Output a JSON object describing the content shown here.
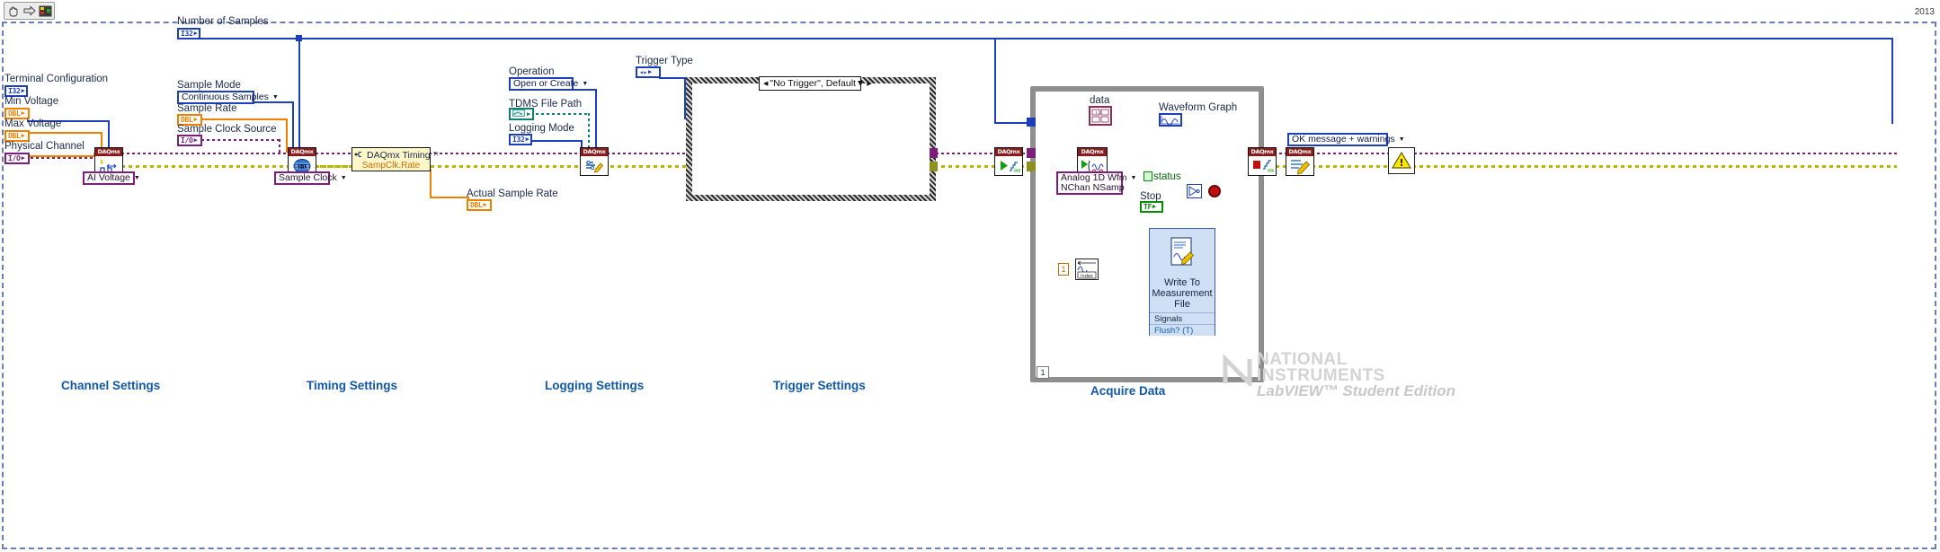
{
  "window": {
    "version_label": "2013",
    "toolbar_buttons": [
      {
        "name": "hand-tool",
        "icon": "hand-icon"
      },
      {
        "name": "run-arrow",
        "icon": "arrow-right-icon"
      },
      {
        "name": "highlight-execution",
        "icon": "bulb-icon"
      }
    ]
  },
  "sections": [
    {
      "label": "Channel Settings"
    },
    {
      "label": "Timing Settings"
    },
    {
      "label": "Logging Settings"
    },
    {
      "label": "Trigger Settings"
    },
    {
      "label": "Acquire Data"
    }
  ],
  "terminals": {
    "number_of_samples": {
      "label": "Number of Samples",
      "type": "I32"
    },
    "terminal_configuration": {
      "label": "Terminal Configuration",
      "type": "I32"
    },
    "min_voltage": {
      "label": "Min Voltage",
      "type": "DBL"
    },
    "max_voltage": {
      "label": "Max Voltage",
      "type": "DBL"
    },
    "physical_channel": {
      "label": "Physical Channel",
      "type": "I/O"
    },
    "sample_rate": {
      "label": "Sample Rate",
      "type": "DBL"
    },
    "sample_clock_source": {
      "label": "Sample Clock Source",
      "type": "I/O"
    },
    "actual_sample_rate": {
      "label": "Actual Sample Rate",
      "type": "DBL"
    },
    "tdms_file_path": {
      "label": "TDMS File Path",
      "type": "PATH"
    },
    "logging_mode": {
      "label": "Logging Mode",
      "type": "I32"
    },
    "trigger_type": {
      "label": "Trigger Type",
      "type": "ENUM"
    },
    "stop": {
      "label": "Stop",
      "type": "TF"
    },
    "status": {
      "label": "status"
    },
    "data": {
      "label": "data"
    },
    "waveform_graph": {
      "label": "Waveform Graph"
    },
    "ok_message": {
      "label": "OK message + warnings"
    }
  },
  "constants": {
    "sample_mode": {
      "label": "Sample Mode",
      "value": "Continuous Samples"
    },
    "operation": {
      "label": "Operation",
      "value": "Open or Create"
    },
    "sample_clock": {
      "value": "Sample Clock"
    },
    "ai_voltage": {
      "value": "AI Voltage"
    },
    "read_mode": {
      "value_line1": "Analog 1D Wfm",
      "value_line2": "NChan NSamp"
    },
    "case_selector": {
      "value": "\"No Trigger\", Default"
    },
    "index_constant": "1",
    "loop_count": "1"
  },
  "nodes": {
    "daqmx_create_channel": {
      "name": "DAQmx Create Virtual Channel",
      "badge": "DAQmx"
    },
    "daqmx_timing": {
      "name": "DAQmx Timing",
      "badge": "DAQmx"
    },
    "daqmx_timing_property": {
      "title": "DAQmx Timing",
      "property": "SampClk.Rate"
    },
    "daqmx_configure_logging": {
      "name": "DAQmx Configure Logging",
      "badge": "DAQmx"
    },
    "daqmx_start_task": {
      "name": "DAQmx Start Task",
      "badge": "DAQmx"
    },
    "daqmx_read": {
      "name": "DAQmx Read",
      "badge": "DAQmx"
    },
    "daqmx_stop_task": {
      "name": "DAQmx Stop Task",
      "badge": "DAQmx"
    },
    "daqmx_clear_task": {
      "name": "DAQmx Clear Task",
      "badge": "DAQmx"
    },
    "simple_error_handler": {
      "name": "Simple Error Handler"
    },
    "write_to_measurement_file": {
      "title_line1": "Write To",
      "title_line2": "Measurement",
      "title_line3": "File",
      "row_signals": "Signals",
      "row_flush": "Flush? (T)"
    }
  },
  "branding": {
    "ni_line1": "NATIONAL",
    "ni_line2": "INSTRUMENTS",
    "lv_text": "LabVIEW™ Student Edition"
  },
  "colors": {
    "wire_blue": "#1c3fbe",
    "wire_orange": "#f08000",
    "wire_io_purple": "#7b1f7b",
    "wire_error_yellow": "#cfcf10",
    "wire_path_teal": "#0f7f74",
    "section_label": "#1059a8",
    "daqmx_header": "#8b1a1a"
  }
}
